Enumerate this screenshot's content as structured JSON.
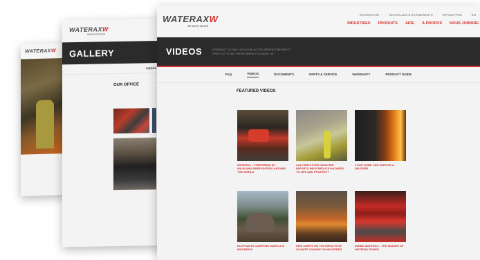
{
  "brand": {
    "name_black": "WATERAX",
    "mark_red": "W",
    "tagline": "WE MOVE WATER",
    "accent_color": "#d32f2f",
    "dark_color": "#2b2b2b"
  },
  "back_page": {
    "logo_word": "WATERAX",
    "logo_mark": "W"
  },
  "middle_page": {
    "logo_word": "WATERAX",
    "logo_mark": "W",
    "logo_tag": "WE MOVE WATER",
    "banner_title": "GALLERY",
    "banner_subtext": "",
    "tab_label": "VIDEOS",
    "section_title": "OUR OFFICE"
  },
  "front_page": {
    "logo_word": "WATERAX",
    "logo_mark": "W",
    "logo_tag": "WE MOVE WATER",
    "utility_nav": [
      "RECHERCHE",
      "NOUVELLES & ÉVÉNEMENTS",
      "INFOLETTRE",
      "EN"
    ],
    "main_nav": [
      "INDUSTRIES",
      "PRODUITS",
      "AIDE",
      "À PROPOS",
      "NOUS JOINDRE"
    ],
    "banner_title": "VIDEOS",
    "banner_subtext": "A PRODUCT IS ONLY AS GOOD AS THE SERVICE BEHIND IT. TRUST US TO BE THERE WHEN YOU NEED US.",
    "tabs": [
      "FAQ",
      "VIDEOS",
      "DOCUMENTS",
      "PARTS & SERVICE",
      "WARRANTY",
      "PRODUCT GUIDE"
    ],
    "active_tab": "VIDEOS",
    "section_title": "FEATURED VIDEOS",
    "videos": [
      {
        "caption": "WATERAX – PREFERRED BY WILDLAND FIREFIGHTERS AROUND THE WORLD",
        "icon": "firefighter-pump-thumbnail"
      },
      {
        "caption": "CAL FIRE'S POST-WILDFIRE EFFORTS HELP REDUCE HAZARDS TO LIFE AND PROPERTY",
        "icon": "chemical-crew-thumbnail"
      },
      {
        "caption": "YOUR HOME CAN SURVIVE A WILDFIRE",
        "icon": "home-fire-thumbnail"
      },
      {
        "caption": "ELEPHANTS CARRYING MARK-3 IN INDONESIA",
        "icon": "elephant-thumbnail"
      },
      {
        "caption": "FIRE CHIEFS ON THE IMPACTS OF CLIMATE CHANGE ON WILDFIRES",
        "icon": "wildfire-thumbnail"
      },
      {
        "caption": "INSIDE WATERAX – THE MAKING OF WATERAX PUMPS",
        "icon": "pumps-thumbnail"
      }
    ]
  }
}
